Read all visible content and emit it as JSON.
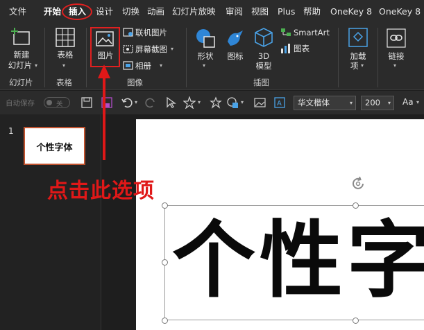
{
  "menu_tabs": [
    "文件",
    "开始",
    "插入",
    "设计",
    "切换",
    "动画",
    "幻灯片放映",
    "审阅",
    "视图",
    "Plus",
    "帮助",
    "OneKey 8",
    "OneKey 8"
  ],
  "ribbon": {
    "new_slide": "新建\n幻灯片",
    "new_slide_line1": "新建",
    "new_slide_line2": "幻灯片",
    "table": "表格",
    "picture": "图片",
    "online_picture": "联机图片",
    "screenshot": "屏幕截图",
    "album": "相册",
    "shapes": "形状",
    "icons": "图标",
    "model_3d_line1": "3D",
    "model_3d_line2": "模型",
    "smartart": "SmartArt",
    "chart": "图表",
    "addins": "加载\n项",
    "addins_line1": "加载",
    "addins_line2": "项",
    "link": "链接",
    "groups": {
      "slides": "幻灯片",
      "tables": "表格",
      "images": "图像",
      "illustrations": "插图"
    }
  },
  "quick_access": {
    "autosave_label": "自动保存",
    "autosave_state": "关",
    "font_name": "华文楷体",
    "font_size": "200",
    "font_case": "Aa"
  },
  "slide_panel": {
    "slide_number": "1",
    "thumb_text": "个性字体"
  },
  "slide": {
    "title_text": "个性字"
  },
  "annotation": {
    "text": "点击此选项",
    "color": "#e01818"
  },
  "colors": {
    "app_bg": "#2b2b2b",
    "workspace_bg": "#1e1e1e",
    "highlight_red": "#e02020",
    "thumb_border": "#c0522e"
  },
  "icons": [
    "new-slide-icon",
    "table-grid-icon",
    "picture-icon",
    "online-picture-icon",
    "screenshot-icon",
    "album-icon",
    "shapes-icon",
    "icons-bird-icon",
    "cube-3d-icon",
    "smartart-icon",
    "chart-icon",
    "addins-icon",
    "link-icon",
    "save-icon",
    "undo-icon",
    "redo-icon",
    "star-icon",
    "rotate-handle-icon"
  ]
}
